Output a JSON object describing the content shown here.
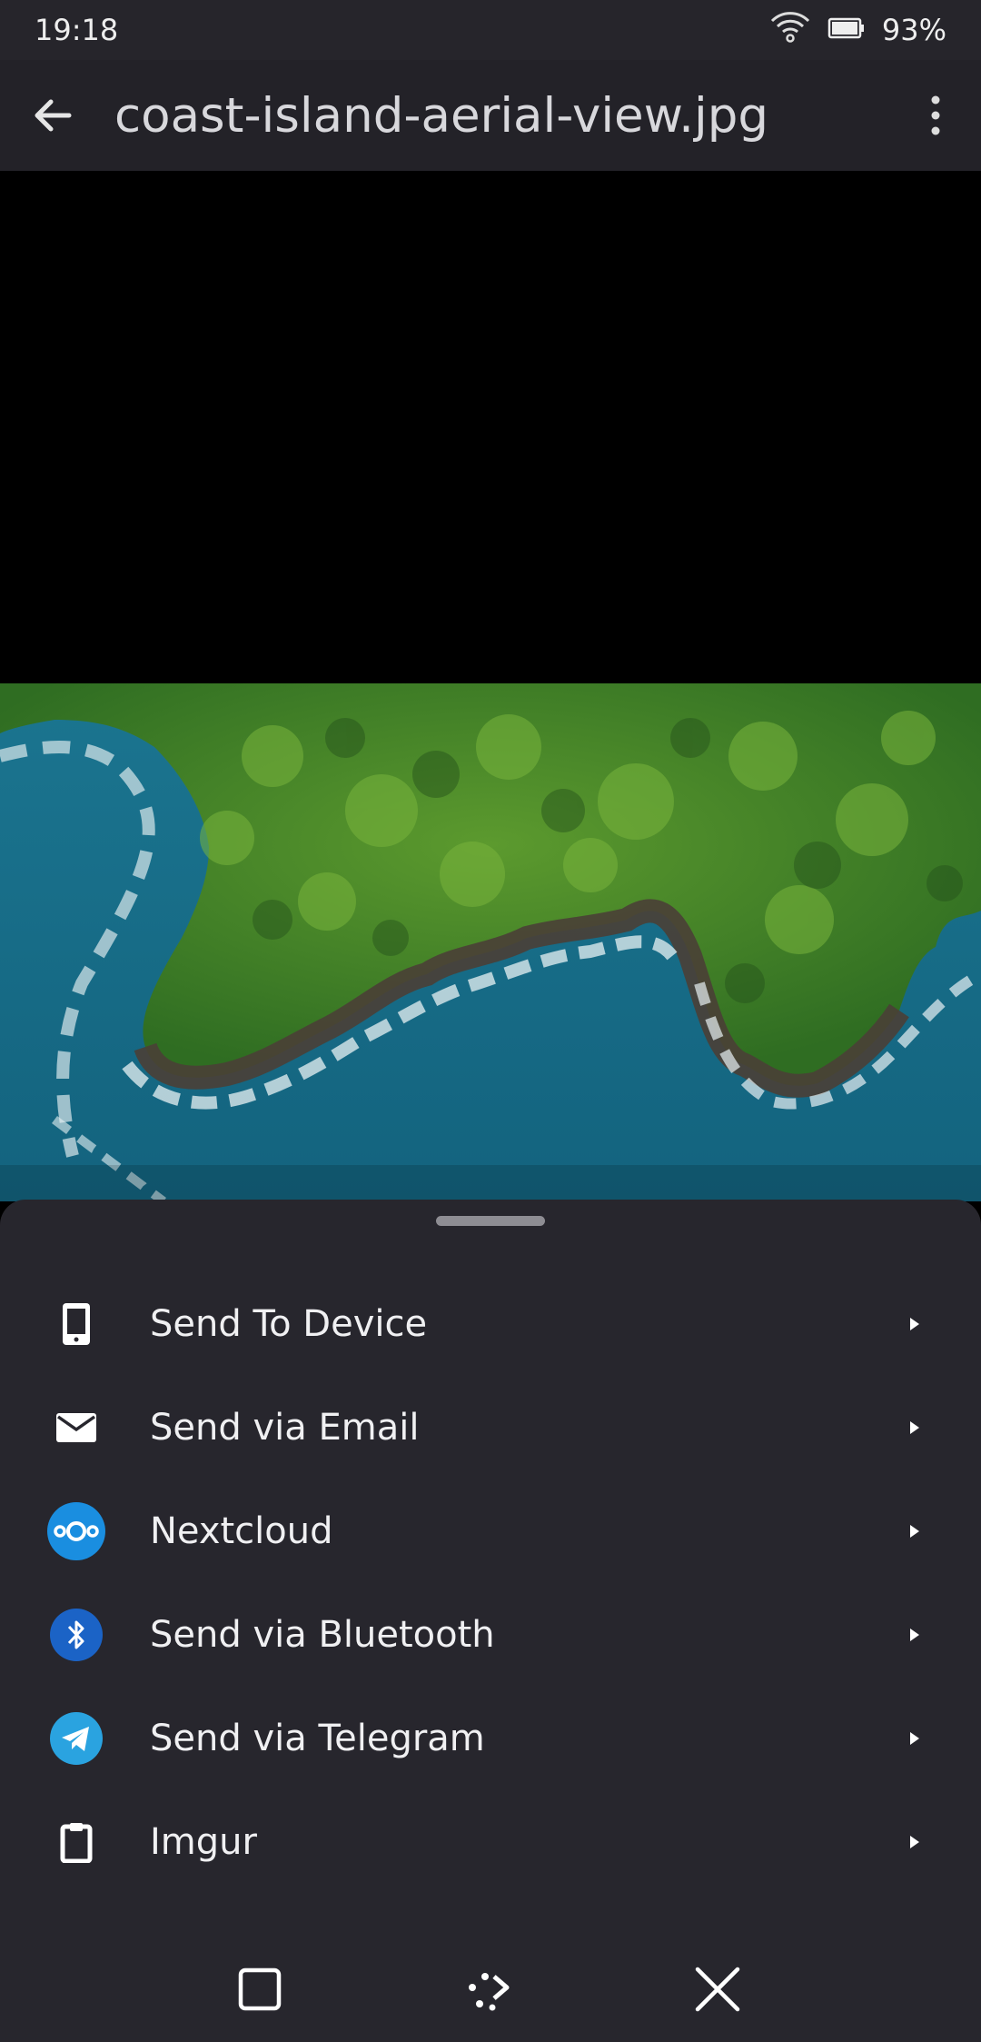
{
  "status": {
    "time": "19:18",
    "battery": "93%"
  },
  "app_bar": {
    "title": "coast-island-aerial-view.jpg"
  },
  "share_sheet": {
    "items": [
      {
        "label": "Send To Device",
        "icon": "phone-icon"
      },
      {
        "label": "Send via Email",
        "icon": "email-icon"
      },
      {
        "label": "Nextcloud",
        "icon": "nextcloud-icon"
      },
      {
        "label": "Send via Bluetooth",
        "icon": "bluetooth-icon"
      },
      {
        "label": "Send via Telegram",
        "icon": "telegram-icon"
      },
      {
        "label": "Imgur",
        "icon": "clipboard-icon"
      }
    ]
  },
  "colors": {
    "background": "#27262d",
    "app_bar": "#232228",
    "nextcloud": "#1a8ee0",
    "bluetooth": "#1b63c6",
    "telegram": "#2aa3e0"
  }
}
